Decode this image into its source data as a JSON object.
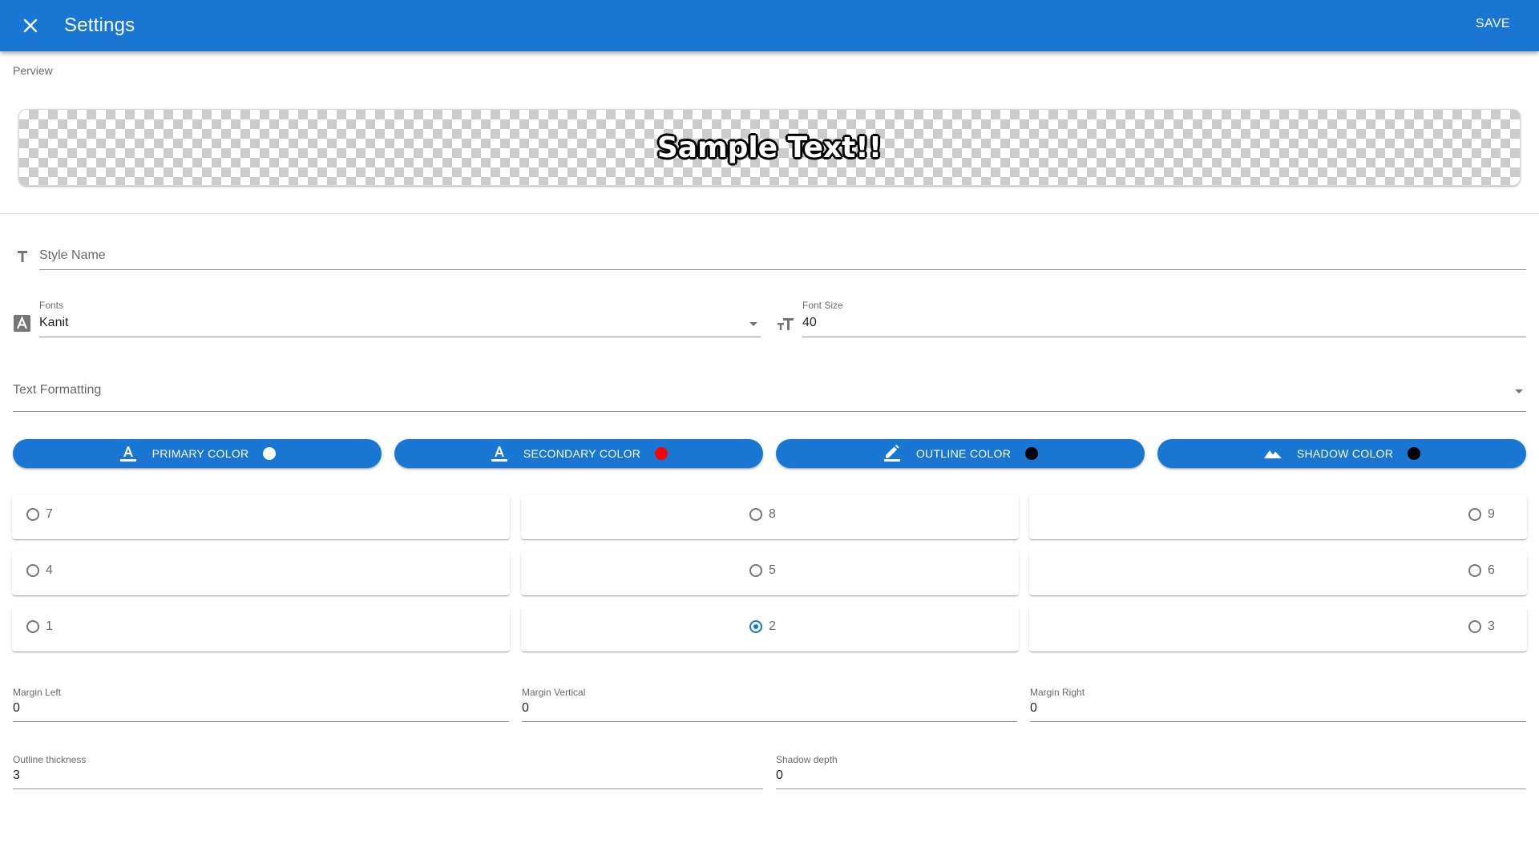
{
  "appbar": {
    "title": "Settings",
    "save_label": "SAVE"
  },
  "preview": {
    "label": "Perview",
    "sample_text": "Sample Text!!"
  },
  "style_name": {
    "placeholder": "Style Name",
    "value": ""
  },
  "fonts": {
    "label": "Fonts",
    "value": "Kanit"
  },
  "font_size": {
    "label": "Font Size",
    "value": "40"
  },
  "text_formatting": {
    "placeholder": "Text Formatting"
  },
  "color_buttons": [
    {
      "label": "PRIMARY COLOR",
      "icon": "format-color-text-icon",
      "color": "#ffffff"
    },
    {
      "label": "SECONDARY COLOR",
      "icon": "format-color-text-icon",
      "color": "#ff0000"
    },
    {
      "label": "OUTLINE COLOR",
      "icon": "pencil-icon",
      "color": "#000000"
    },
    {
      "label": "SHADOW COLOR",
      "icon": "terrain-icon",
      "color": "#000000"
    }
  ],
  "alignment": {
    "rows": [
      [
        "7",
        "8",
        "9"
      ],
      [
        "4",
        "5",
        "6"
      ],
      [
        "1",
        "2",
        "3"
      ]
    ],
    "selected": "2"
  },
  "margins": {
    "left": {
      "label": "Margin Left",
      "value": "0"
    },
    "vertical": {
      "label": "Margin Vertical",
      "value": "0"
    },
    "right": {
      "label": "Margin Right",
      "value": "0"
    }
  },
  "outline_thickness": {
    "label": "Outline thickness",
    "value": "3"
  },
  "shadow_depth": {
    "label": "Shadow depth",
    "value": "0"
  },
  "colors": {
    "primary": "#1976d2"
  }
}
